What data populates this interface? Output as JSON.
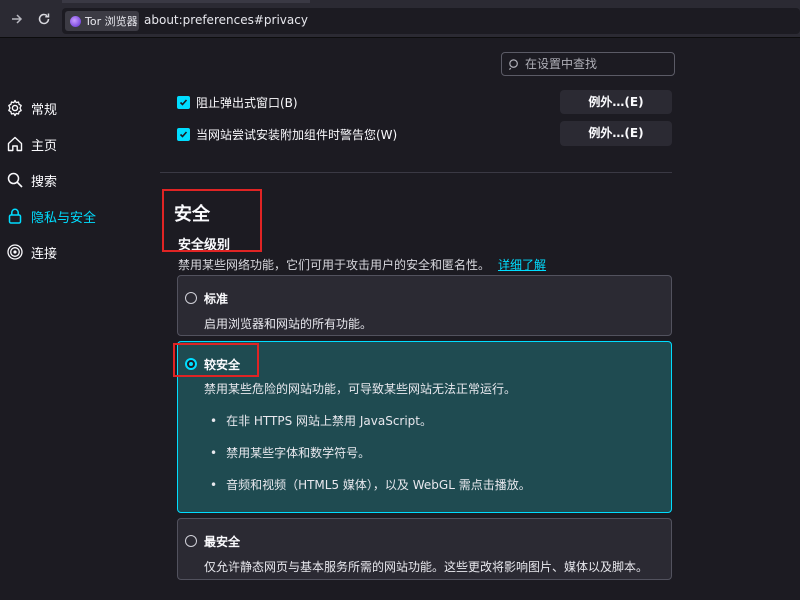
{
  "browser": {
    "identity_label": "Tor 浏览器",
    "url": "about:preferences#privacy"
  },
  "search": {
    "placeholder": "在设置中查找"
  },
  "sidebar": {
    "items": [
      {
        "label": "常规",
        "icon": "gear-icon"
      },
      {
        "label": "主页",
        "icon": "home-icon"
      },
      {
        "label": "搜索",
        "icon": "search-icon"
      },
      {
        "label": "隐私与安全",
        "icon": "lock-icon",
        "active": true
      },
      {
        "label": "连接",
        "icon": "connection-icon"
      }
    ]
  },
  "permissions": {
    "popup_label": "阻止弹出式窗口(B)",
    "addon_label": "当网站尝试安装附加组件时警告您(W)",
    "exceptions_label": "例外…(E)"
  },
  "security": {
    "title": "安全",
    "level_heading": "安全级别",
    "description": "禁用某些网络功能，它们可用于攻击用户的安全和匿名性。",
    "learn_more": "详细了解",
    "levels": [
      {
        "name": "标准",
        "description": "启用浏览器和网站的所有功能。"
      },
      {
        "name": "较安全",
        "description": "禁用某些危险的网站功能，可导致某些网站无法正常运行。",
        "bullets": [
          "在非 HTTPS 网站上禁用 JavaScript。",
          "禁用某些字体和数学符号。",
          "音频和视频（HTML5 媒体），以及 WebGL 需点击播放。"
        ]
      },
      {
        "name": "最安全",
        "description": "仅允许静态网页与基本服务所需的网站功能。这些更改将影响图片、媒体以及脚本。"
      }
    ]
  },
  "colors": {
    "accent": "#00ddff",
    "background": "#1c1b22",
    "selected_card": "#1f4b51",
    "annotation_red": "#e02424"
  }
}
